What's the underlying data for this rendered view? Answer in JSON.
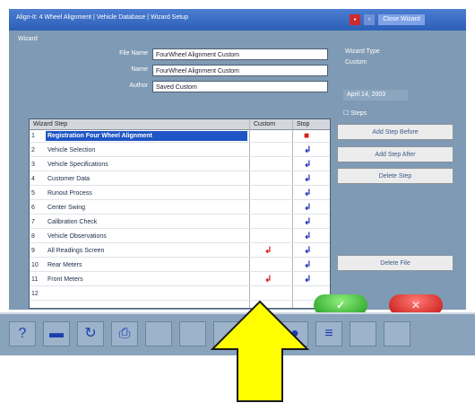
{
  "window": {
    "title": "Align-It: 4 Wheel Alignment  |  Vehicle Database  |  Wizard Setup",
    "buttons": {
      "min": "",
      "max": "",
      "close": "Close Wizard"
    }
  },
  "wizard": {
    "label": "Wizard",
    "file_name_label": "File Name",
    "file_name_value": "FourWheel Alignment Custom",
    "name_label": "Name",
    "name_value": "FourWheel Alignment Custom",
    "author_label": "Author",
    "author_value": "Saved Custom",
    "wizard_type_label": "Wizard Type",
    "wizard_type_value": "Custom",
    "date": "April 14, 2003",
    "version": "Steps"
  },
  "steps_table": {
    "headers": {
      "step": "Wizard Step",
      "custom": "Custom",
      "stop": "Stop"
    },
    "rows": [
      {
        "num": "1",
        "label": "Registration Four Wheel Alignment",
        "selected": true,
        "custom": "",
        "stop": "square"
      },
      {
        "num": "2",
        "label": "Vehicle Selection",
        "selected": false,
        "custom": "",
        "stop": "check"
      },
      {
        "num": "3",
        "label": "Vehicle Specifications",
        "selected": false,
        "custom": "",
        "stop": "check"
      },
      {
        "num": "4",
        "label": "Customer Data",
        "selected": false,
        "custom": "",
        "stop": "check"
      },
      {
        "num": "5",
        "label": "Runout Process",
        "selected": false,
        "custom": "",
        "stop": "check"
      },
      {
        "num": "6",
        "label": "Center Swing",
        "selected": false,
        "custom": "",
        "stop": "check"
      },
      {
        "num": "7",
        "label": "Calibration Check",
        "selected": false,
        "custom": "",
        "stop": "check"
      },
      {
        "num": "8",
        "label": "Vehicle Observations",
        "selected": false,
        "custom": "",
        "stop": "check"
      },
      {
        "num": "9",
        "label": "All Readings Screen",
        "selected": false,
        "custom": "check",
        "stop": "check"
      },
      {
        "num": "10",
        "label": "Rear Meters",
        "selected": false,
        "custom": "",
        "stop": "check"
      },
      {
        "num": "11",
        "label": "Front Meters",
        "selected": false,
        "custom": "check",
        "stop": "check"
      },
      {
        "num": "12",
        "label": "",
        "selected": false,
        "custom": "",
        "stop": ""
      }
    ]
  },
  "buttons": {
    "add_before": "Add Step Before",
    "add_after": "Add Step After",
    "delete": "Delete Step",
    "delete_file": "Delete File",
    "ok": "✓",
    "cancel": "✕"
  },
  "toolbar": {
    "icons": [
      "help-icon",
      "vehicle-icon",
      "refresh-icon",
      "printer-icon",
      "blank-icon",
      "home-icon",
      "blank-icon",
      "blank-icon",
      "tire-icon",
      "menu-icon",
      "blank-icon",
      "blank-icon"
    ]
  },
  "colors": {
    "window_bg": "#7f9ab4",
    "title_bar": "#2c5fb7",
    "selected_row": "#1f55c4",
    "ok": "#2dbf2d",
    "cancel": "#d42020",
    "arrow": "#ffff00"
  }
}
